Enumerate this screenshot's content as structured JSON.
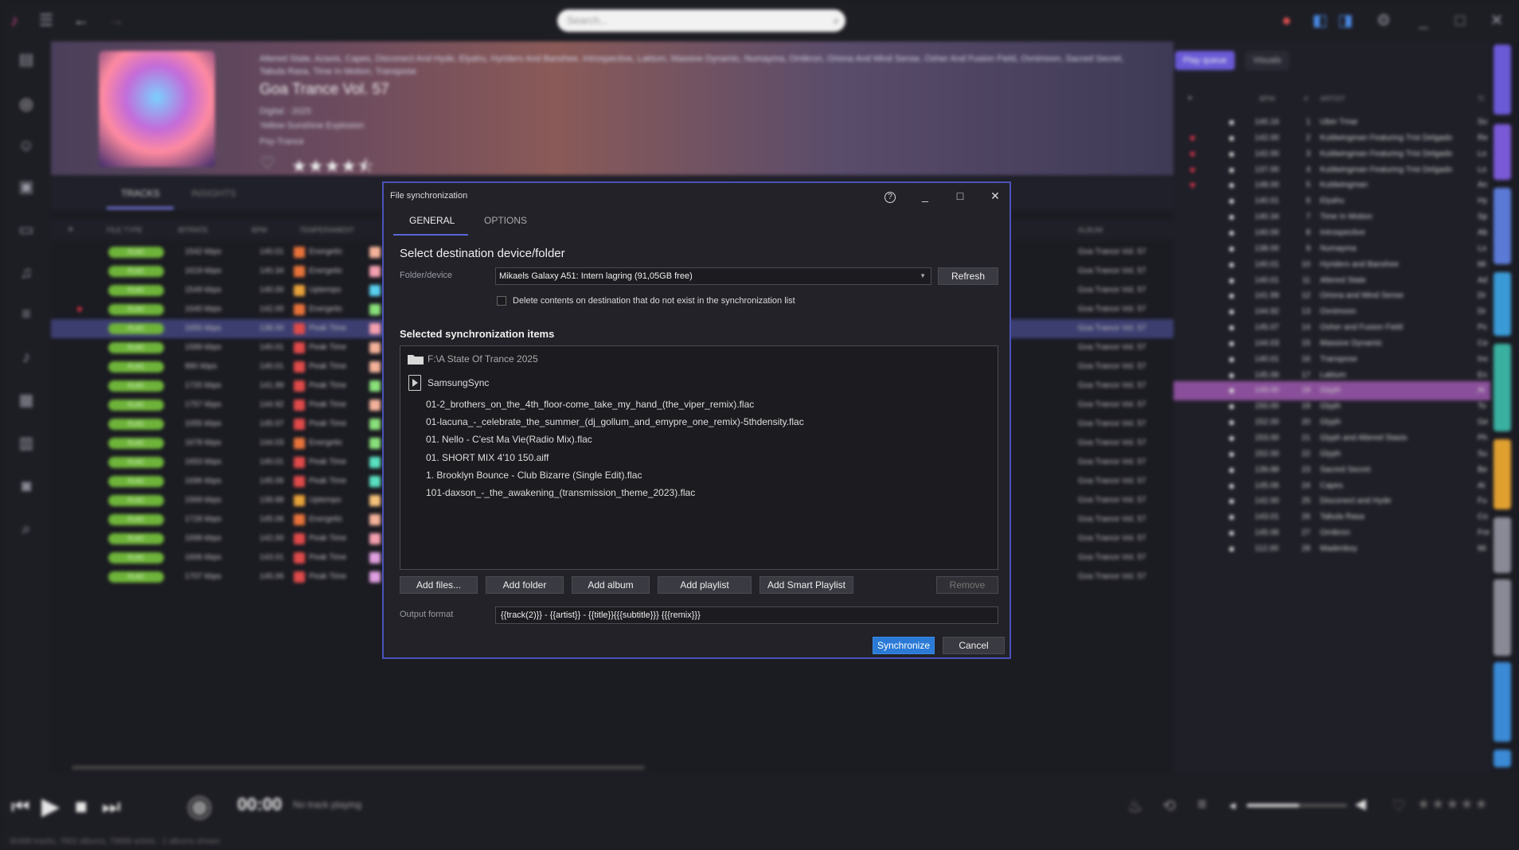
{
  "topbar": {
    "search_placeholder": "Search..."
  },
  "album": {
    "artists": "Altered State, Azaxis, Capes, Disconect And Hyde, Elyahu, Hyriders And Banshee, Introspective, Laktum, Massive Dynamic, Numayma, Omikron, Oriona And Mind Sense, Osher And Fusion Field, Ovnimoon, Sacred Secret, Tabula Rasa, Time In Motion, Transpose",
    "title": "Goa Trance Vol. 57",
    "format_year": "Digital · 2025",
    "label": "Yellow Sunshine Explosion",
    "genre": "Psy-Trance",
    "rating": 4.5,
    "stars": "★★★★⯪"
  },
  "tabs": {
    "tracks": "TRACKS",
    "insights": "INSIGHTS"
  },
  "columns": {
    "file_type": "FILE TYPE",
    "bitrate": "BITRATE",
    "bpm": "BPM",
    "temperament": "TEMPERAMENT",
    "album": "ALBUM"
  },
  "tracks": [
    {
      "type": "FLAC",
      "bitrate": "1542 kbps",
      "bpm": "140.01",
      "temp": "Energetic",
      "tcolor": "#e8733a",
      "ccolor": "#f4b29a",
      "album": "Goa Trance Vol. 57",
      "loved": false
    },
    {
      "type": "FLAC",
      "bitrate": "1619 kbps",
      "bpm": "140.34",
      "temp": "Energetic",
      "tcolor": "#e8733a",
      "ccolor": "#f4a0b0",
      "album": "Goa Trance Vol. 57",
      "loved": false
    },
    {
      "type": "FLAC",
      "bitrate": "1549 kbps",
      "bpm": "140.00",
      "temp": "Uptempo",
      "tcolor": "#e8a23a",
      "ccolor": "#5ad0f0",
      "album": "Goa Trance Vol. 57",
      "loved": false
    },
    {
      "type": "FLAC",
      "bitrate": "1640 kbps",
      "bpm": "142.00",
      "temp": "Energetic",
      "tcolor": "#e8733a",
      "ccolor": "#8ae07a",
      "album": "Goa Trance Vol. 57",
      "loved": true
    },
    {
      "type": "FLAC",
      "bitrate": "1650 kbps",
      "bpm": "138.00",
      "temp": "Peak Time",
      "tcolor": "#e04a4a",
      "ccolor": "#f4a0b0",
      "album": "Goa Trance Vol. 57",
      "loved": false
    },
    {
      "type": "FLAC",
      "bitrate": "1589 kbps",
      "bpm": "140.01",
      "temp": "Peak Time",
      "tcolor": "#e04a4a",
      "ccolor": "#f4b29a",
      "album": "Goa Trance Vol. 57",
      "loved": false
    },
    {
      "type": "FLAC",
      "bitrate": "990 kbps",
      "bpm": "140.01",
      "temp": "Peak Time",
      "tcolor": "#e04a4a",
      "ccolor": "#f4b29a",
      "album": "Goa Trance Vol. 57",
      "loved": false
    },
    {
      "type": "FLAC",
      "bitrate": "1720 kbps",
      "bpm": "141.99",
      "temp": "Peak Time",
      "tcolor": "#e04a4a",
      "ccolor": "#8ae07a",
      "album": "Goa Trance Vol. 57",
      "loved": false
    },
    {
      "type": "FLAC",
      "bitrate": "1757 kbps",
      "bpm": "144.92",
      "temp": "Peak Time",
      "tcolor": "#e04a4a",
      "ccolor": "#f4b29a",
      "album": "Goa Trance Vol. 57",
      "loved": false
    },
    {
      "type": "FLAC",
      "bitrate": "1055 kbps",
      "bpm": "145.07",
      "temp": "Peak Time",
      "tcolor": "#e04a4a",
      "ccolor": "#8ae07a",
      "album": "Goa Trance Vol. 57",
      "loved": false
    },
    {
      "type": "FLAC",
      "bitrate": "1678 kbps",
      "bpm": "144.03",
      "temp": "Energetic",
      "tcolor": "#e8733a",
      "ccolor": "#8ae07a",
      "album": "Goa Trance Vol. 57",
      "loved": false
    },
    {
      "type": "FLAC",
      "bitrate": "1653 kbps",
      "bpm": "140.01",
      "temp": "Peak Time",
      "tcolor": "#e04a4a",
      "ccolor": "#5ae0c0",
      "album": "Goa Trance Vol. 57",
      "loved": false
    },
    {
      "type": "FLAC",
      "bitrate": "1696 kbps",
      "bpm": "145.06",
      "temp": "Peak Time",
      "tcolor": "#e04a4a",
      "ccolor": "#5ae0c0",
      "album": "Goa Trance Vol. 57",
      "loved": false
    },
    {
      "type": "FLAC",
      "bitrate": "1569 kbps",
      "bpm": "139.88",
      "temp": "Uptempo",
      "tcolor": "#e8a23a",
      "ccolor": "#f4c07a",
      "album": "Goa Trance Vol. 57",
      "loved": false
    },
    {
      "type": "FLAC",
      "bitrate": "1728 kbps",
      "bpm": "145.06",
      "temp": "Energetic",
      "tcolor": "#e8733a",
      "ccolor": "#f4b29a",
      "album": "Goa Trance Vol. 57",
      "loved": false
    },
    {
      "type": "FLAC",
      "bitrate": "1699 kbps",
      "bpm": "142.00",
      "temp": "Peak Time",
      "tcolor": "#e04a4a",
      "ccolor": "#f4a0b0",
      "album": "Goa Trance Vol. 57",
      "loved": false
    },
    {
      "type": "FLAC",
      "bitrate": "1606 kbps",
      "bpm": "143.01",
      "temp": "Peak Time",
      "tcolor": "#e04a4a",
      "ccolor": "#e0a0e0",
      "album": "Goa Trance Vol. 57",
      "loved": false
    },
    {
      "type": "FLAC",
      "bitrate": "1707 kbps",
      "bpm": "145.06",
      "temp": "Peak Time",
      "tcolor": "#e04a4a",
      "ccolor": "#e0a0e0",
      "album": "Goa Trance Vol. 57",
      "loved": false
    }
  ],
  "queue": {
    "tab_play_queue": "Play queue",
    "tab_visuals": "Visuals",
    "col_bpm": "BPM",
    "col_num": "#",
    "col_artist": "ARTIST",
    "col_title": "TI",
    "items": [
      {
        "bpm": "140.16",
        "n": "1",
        "artist": "Uber Tmar",
        "t": "So",
        "loved": false
      },
      {
        "bpm": "142.00",
        "n": "2",
        "artist": "Kuldwingman Featuring Trisi Delgado",
        "t": "Re",
        "loved": true
      },
      {
        "bpm": "142.00",
        "n": "3",
        "artist": "Kuldwingman Featuring Trisi Delgado",
        "t": "Lo",
        "loved": true
      },
      {
        "bpm": "137.00",
        "n": "4",
        "artist": "Kuldwingman Featuring Trisi Delgado",
        "t": "Lo",
        "loved": true
      },
      {
        "bpm": "148.00",
        "n": "5",
        "artist": "Kuldwingman",
        "t": "An",
        "loved": true
      },
      {
        "bpm": "140.01",
        "n": "6",
        "artist": "Elyahu",
        "t": "Hy",
        "loved": false
      },
      {
        "bpm": "140.34",
        "n": "7",
        "artist": "Time In Motion",
        "t": "Sp",
        "loved": false
      },
      {
        "bpm": "140.00",
        "n": "8",
        "artist": "Introspective",
        "t": "Ab",
        "loved": false
      },
      {
        "bpm": "138.00",
        "n": "9",
        "artist": "Numayma",
        "t": "Lo",
        "loved": false
      },
      {
        "bpm": "140.01",
        "n": "10",
        "artist": "Hyriders and Banshee",
        "t": "Mi",
        "loved": false
      },
      {
        "bpm": "140.01",
        "n": "11",
        "artist": "Altered State",
        "t": "Ad",
        "loved": false
      },
      {
        "bpm": "141.99",
        "n": "12",
        "artist": "Oriona and Mind Sense",
        "t": "Dr",
        "loved": false
      },
      {
        "bpm": "144.92",
        "n": "13",
        "artist": "Ovnimoon",
        "t": "Dr",
        "loved": false
      },
      {
        "bpm": "145.07",
        "n": "14",
        "artist": "Osher and Fusion Field",
        "t": "Ps",
        "loved": false
      },
      {
        "bpm": "144.03",
        "n": "15",
        "artist": "Massive Dynamic",
        "t": "Ce",
        "loved": false
      },
      {
        "bpm": "140.01",
        "n": "16",
        "artist": "Transpose",
        "t": "Inc",
        "loved": false
      },
      {
        "bpm": "145.06",
        "n": "17",
        "artist": "Laktum",
        "t": "En",
        "loved": false
      },
      {
        "bpm": "149.00",
        "n": "18",
        "artist": "Glyph",
        "t": "Al",
        "loved": false,
        "selected": true
      },
      {
        "bpm": "150.00",
        "n": "19",
        "artist": "Glyph",
        "t": "To",
        "loved": false
      },
      {
        "bpm": "152.00",
        "n": "20",
        "artist": "Glyph",
        "t": "Ge",
        "loved": false
      },
      {
        "bpm": "153.00",
        "n": "21",
        "artist": "Glyph and Altered Stasis",
        "t": "Ph",
        "loved": false
      },
      {
        "bpm": "152.00",
        "n": "22",
        "artist": "Glyph",
        "t": "Su",
        "loved": false
      },
      {
        "bpm": "139.88",
        "n": "23",
        "artist": "Sacred Secret",
        "t": "Be",
        "loved": false
      },
      {
        "bpm": "145.06",
        "n": "24",
        "artist": "Capes",
        "t": "At",
        "loved": false
      },
      {
        "bpm": "142.00",
        "n": "25",
        "artist": "Disconect and Hyde",
        "t": "Fu",
        "loved": false
      },
      {
        "bpm": "143.01",
        "n": "26",
        "artist": "Tabula Rasa",
        "t": "Co",
        "loved": false
      },
      {
        "bpm": "145.06",
        "n": "27",
        "artist": "Omikron",
        "t": "Fre",
        "loved": false
      },
      {
        "bpm": "112.00",
        "n": "28",
        "artist": "Madenboy",
        "t": "Mi",
        "loved": false
      }
    ]
  },
  "vtabs": {
    "colors": [
      "#6a5ad6",
      "#7a5ad6",
      "#5a7ad6",
      "#3a9ad6",
      "#3ab0a0",
      "#e0a030",
      "#8a8a96",
      "#8a8a96",
      "#3a8ad6",
      "#3a8ad6"
    ]
  },
  "player": {
    "time": "00:00",
    "now_playing": "No track playing",
    "status": "30499 tracks, 7802 albums, 79999 artists · 1 albums shown",
    "volume": 0.52
  },
  "dialog": {
    "title": "File synchronization",
    "tab_general": "GENERAL",
    "tab_options": "OPTIONS",
    "heading_dest": "Select destination device/folder",
    "folder_label": "Folder/device",
    "device_value": "Mikaels Galaxy A51: Intern lagring (91,05GB free)",
    "refresh": "Refresh",
    "delete_label": "Delete contents on destination that do not exist in the synchronization list",
    "heading_items": "Selected synchronization items",
    "folder_item": "F:\\A State Of Trance 2025",
    "playlist_item": "SamsungSync",
    "files": [
      "01-2_brothers_on_the_4th_floor-come_take_my_hand_(the_viper_remix).flac",
      "01-lacuna_-_celebrate_the_summer_(dj_gollum_and_emypre_one_remix)-5thdensity.flac",
      "01. Nello - C'est Ma Vie(Radio Mix).flac",
      "01. SHORT MIX  4'10  150.aiff",
      "1. Brooklyn Bounce - Club Bizarre (Single Edit).flac",
      "101-daxson_-_the_awakening_(transmission_theme_2023).flac"
    ],
    "add_files": "Add files...",
    "add_folder": "Add folder",
    "add_album": "Add album",
    "add_playlist": "Add playlist",
    "add_smart_playlist": "Add Smart Playlist",
    "remove": "Remove",
    "output_label": "Output format",
    "output_value": "{{track(2)}} - {{artist}} - {{title}}{{{subtitle}}} {{{remix}}}",
    "synchronize": "Synchronize",
    "cancel": "Cancel",
    "help_glyph": "?",
    "minimize_glyph": "_",
    "maximize_glyph": "□",
    "close_glyph": "✕"
  }
}
